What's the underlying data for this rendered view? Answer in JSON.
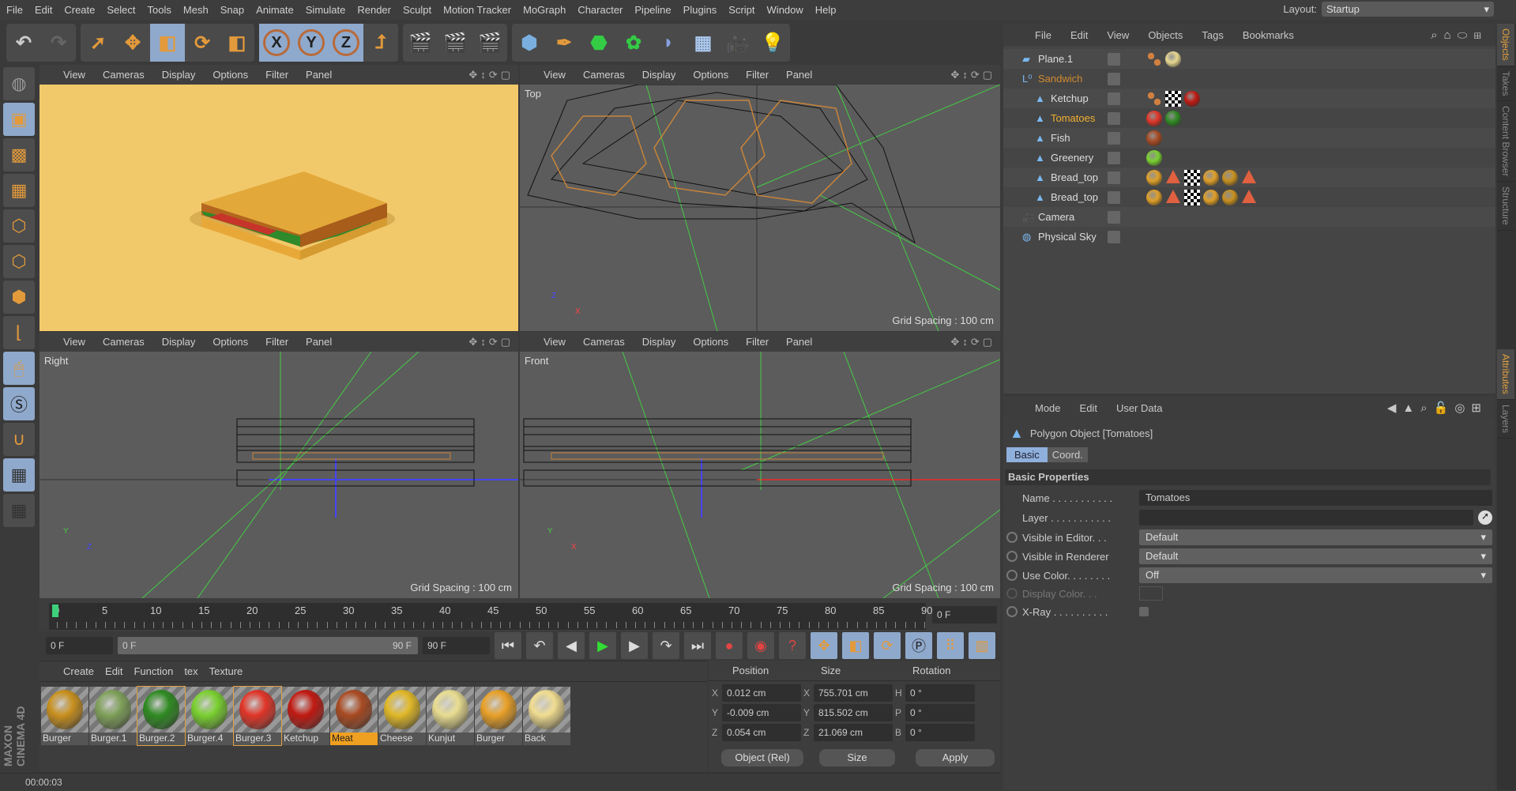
{
  "menu": [
    "File",
    "Edit",
    "Create",
    "Select",
    "Tools",
    "Mesh",
    "Snap",
    "Animate",
    "Simulate",
    "Render",
    "Sculpt",
    "Motion Tracker",
    "MoGraph",
    "Character",
    "Pipeline",
    "Plugins",
    "Script",
    "Window",
    "Help"
  ],
  "layout": {
    "label": "Layout:",
    "value": "Startup"
  },
  "viewport_menu": [
    "View",
    "Cameras",
    "Display",
    "Options",
    "Filter",
    "Panel"
  ],
  "viewports": [
    {
      "label": "",
      "grid": ""
    },
    {
      "label": "Top",
      "grid": "Grid Spacing : 100 cm"
    },
    {
      "label": "Right",
      "grid": "Grid Spacing : 100 cm"
    },
    {
      "label": "Front",
      "grid": "Grid Spacing : 100 cm"
    }
  ],
  "timeline": {
    "ticks": [
      "0",
      "5",
      "10",
      "15",
      "20",
      "25",
      "30",
      "35",
      "40",
      "45",
      "50",
      "55",
      "60",
      "65",
      "70",
      "75",
      "80",
      "85",
      "90"
    ],
    "current": "0 F",
    "start": "0 F",
    "range_start": "0 F",
    "range_end": "90 F",
    "end": "90 F"
  },
  "materials": {
    "menu": [
      "Create",
      "Edit",
      "Function",
      "tex",
      "Texture"
    ],
    "items": [
      {
        "name": "Burger",
        "color": "#c8901e"
      },
      {
        "name": "Burger.1",
        "color": "#7fa05a"
      },
      {
        "name": "Burger.2",
        "color": "#2f8a22"
      },
      {
        "name": "Burger.4",
        "color": "#7ad030"
      },
      {
        "name": "Burger.3",
        "color": "#e03528"
      },
      {
        "name": "Ketchup",
        "color": "#c01a12"
      },
      {
        "name": "Meat",
        "color": "#a84a22"
      },
      {
        "name": "Cheese",
        "color": "#e0b828"
      },
      {
        "name": "Kunjut",
        "color": "#e8dc90"
      },
      {
        "name": "Burger",
        "color": "#e8a028"
      },
      {
        "name": "Back",
        "color": "#f0dc90"
      }
    ]
  },
  "coords": {
    "headers": [
      "Position",
      "Size",
      "Rotation"
    ],
    "rows": [
      {
        "pa": "X",
        "p": "0.012 cm",
        "sa": "X",
        "s": "755.701 cm",
        "ra": "H",
        "r": "0 °"
      },
      {
        "pa": "Y",
        "p": "-0.009 cm",
        "sa": "Y",
        "s": "815.502 cm",
        "ra": "P",
        "r": "0 °"
      },
      {
        "pa": "Z",
        "p": "0.054 cm",
        "sa": "Z",
        "s": "21.069 cm",
        "ra": "B",
        "r": "0 °"
      }
    ],
    "mode": "Object (Rel)",
    "size_mode": "Size",
    "apply": "Apply"
  },
  "status": "00:00:03",
  "logo": "MAXON CINEMA 4D",
  "objects": {
    "menu": [
      "File",
      "Edit",
      "View",
      "Objects",
      "Tags",
      "Bookmarks"
    ],
    "items": [
      {
        "name": "Plane.1",
        "indent": 0,
        "tags": [
          "dots",
          "#e8d890"
        ]
      },
      {
        "name": "Sandwich",
        "indent": 0,
        "group": true,
        "tags": []
      },
      {
        "name": "Ketchup",
        "indent": 1,
        "tags": [
          "dots",
          "chk",
          "#c01a12"
        ]
      },
      {
        "name": "Tomatoes",
        "indent": 1,
        "selected": true,
        "tags": [
          "#e03528",
          "#2f8a22"
        ]
      },
      {
        "name": "Fish",
        "indent": 1,
        "tags": [
          "#a84a22"
        ]
      },
      {
        "name": "Greenery",
        "indent": 1,
        "tags": [
          "#7ad030"
        ]
      },
      {
        "name": "Bread_top",
        "indent": 1,
        "tags": [
          "#e0a028",
          "tri",
          "chk",
          "#e0a028",
          "#c8901e",
          "tri"
        ]
      },
      {
        "name": "Bread_top",
        "indent": 1,
        "tags": [
          "#e0a028",
          "tri",
          "chk",
          "#e0a028",
          "#c8901e",
          "tri"
        ]
      },
      {
        "name": "Camera",
        "indent": 0,
        "tags": []
      },
      {
        "name": "Physical Sky",
        "indent": 0,
        "tags": []
      }
    ]
  },
  "attributes": {
    "menu": [
      "Mode",
      "Edit",
      "User Data"
    ],
    "title": "Polygon Object [Tomatoes]",
    "tabs": [
      "Basic",
      "Coord."
    ],
    "section": "Basic Properties",
    "name_label": "Name . . . . . . . . . . .",
    "name_value": "Tomatoes",
    "layer_label": "Layer . . . . . . . . . . .",
    "vis_editor_label": "Visible in Editor. . .",
    "vis_editor": "Default",
    "vis_render_label": "Visible in Renderer",
    "vis_render": "Default",
    "use_color_label": "Use Color. . . . . . . .",
    "use_color": "Off",
    "display_color_label": "Display Color. . .",
    "xray_label": "X-Ray . . . . . . . . . ."
  },
  "side_tabs": [
    "Objects",
    "Takes",
    "Content Browser",
    "Structure"
  ],
  "side_tabs2": [
    "Attributes",
    "Layers"
  ]
}
